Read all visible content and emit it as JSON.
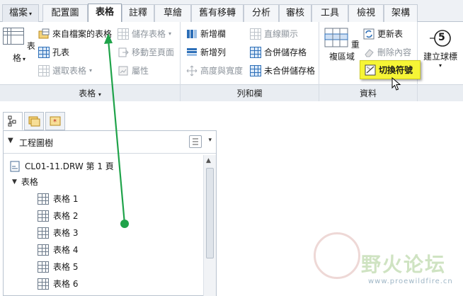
{
  "tabs": [
    {
      "label": "檔案",
      "dropdown": "▾"
    },
    {
      "label": "配置圖"
    },
    {
      "label": "表格",
      "active": true
    },
    {
      "label": "註釋"
    },
    {
      "label": "草繪"
    },
    {
      "label": "舊有移轉"
    },
    {
      "label": "分析"
    },
    {
      "label": "審核"
    },
    {
      "label": "工具"
    },
    {
      "label": "檢視"
    },
    {
      "label": "架構"
    }
  ],
  "ribbon": {
    "table_group": {
      "footer": "表格",
      "footer_caret": "▾",
      "big_table": "表格",
      "big_table_caret": "▾",
      "from_file": "來自檔案的表格",
      "hole_table": "孔表",
      "select_table": "選取表格",
      "select_table_caret": "▾",
      "save_table": "儲存表格",
      "save_table_caret": "▾",
      "move_to_page": "移動至頁面",
      "properties": "屬性"
    },
    "rows_cols_group": {
      "footer": "列和欄",
      "add_column": "新增欄",
      "add_row": "新增列",
      "height_width": "高度與寬度",
      "straight_display": "直線顯示",
      "merge_cells": "合併儲存格",
      "unmerge_cells": "未合併儲存格"
    },
    "data_group": {
      "footer": "資料",
      "repeat_region": "重複區域",
      "update_table": "更新表",
      "delete_content": "刪除內容",
      "switch_symbol": "切換符號"
    },
    "balloon_group": {
      "create_balloon": "建立球標",
      "balloon_number": "5",
      "caret": "▾"
    }
  },
  "panel": {
    "title": "工程圖樹",
    "caret": "▼",
    "options_caret": "▾",
    "tree": {
      "root": "CL01-11.DRW 第 1 頁",
      "folder": "表格",
      "folder_caret": "▼",
      "items": [
        "表格 1",
        "表格 2",
        "表格 3",
        "表格 4",
        "表格 5",
        "表格 6"
      ]
    },
    "scroll_up": "▲"
  },
  "watermark": {
    "text": "野火论坛",
    "url": "www.proewildfire.cn"
  },
  "colors": {
    "accent_arrow": "#1fa34a",
    "highlight": "#f6f536"
  }
}
